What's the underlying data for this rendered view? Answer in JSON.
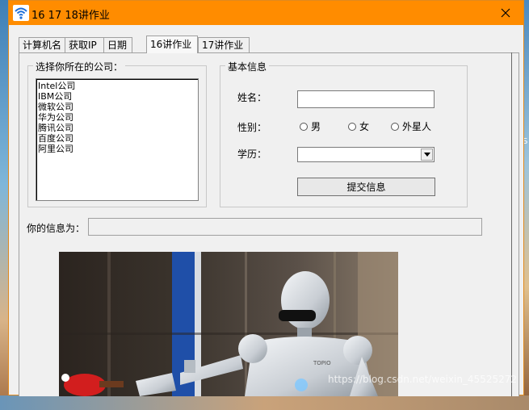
{
  "window": {
    "title": "16 17 18讲作业",
    "title_bar_color": "#ff8c00",
    "close_symbol": "✕"
  },
  "tabs": [
    {
      "label": "计算机名",
      "active": false
    },
    {
      "label": "获取IP",
      "active": false
    },
    {
      "label": "日期",
      "active": false
    },
    {
      "label": "16讲作业",
      "active": true
    },
    {
      "label": "17讲作业",
      "active": false
    }
  ],
  "company_group": {
    "legend": "选择你所在的公司：",
    "items": [
      "Intel公司",
      "IBM公司",
      "微软公司",
      "华为公司",
      "腾讯公司",
      "百度公司",
      "阿里公司"
    ]
  },
  "basic_info": {
    "legend": "基本信息",
    "name_label": "姓名：",
    "name_value": "",
    "gender_label": "性别：",
    "gender_options": [
      "男",
      "女",
      "外星人"
    ],
    "education_label": "学历：",
    "education_value": "",
    "submit_label": "提交信息"
  },
  "info_label": "你的信息为：",
  "info_value": "",
  "background_edge_text": "S",
  "watermark": "https://blog.csdn.net/weixin_45525272",
  "icons": {
    "app": "wifi-icon",
    "close": "close-icon",
    "combo": "chevron-down-icon"
  }
}
